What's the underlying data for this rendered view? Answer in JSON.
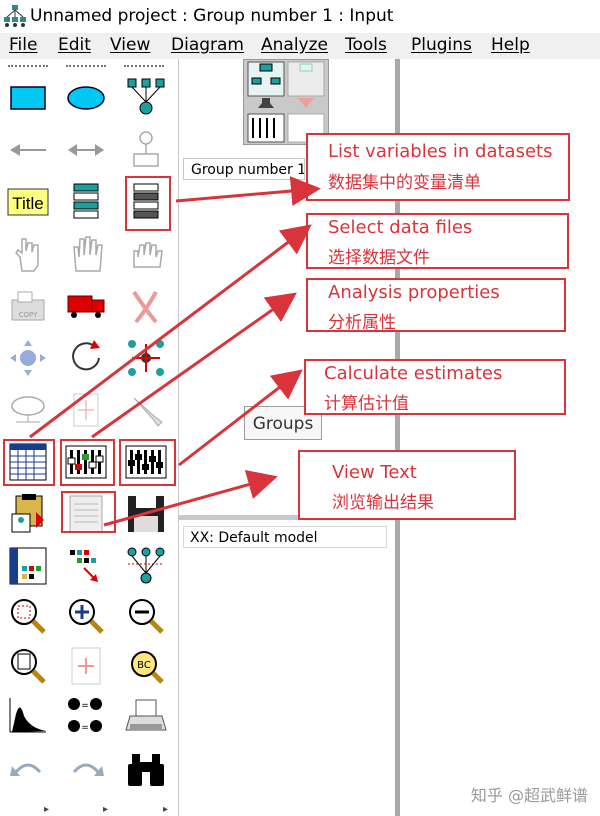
{
  "window": {
    "title": "Unnamed project : Group number 1 : Input"
  },
  "menu": [
    "File",
    "Edit",
    "View",
    "Diagram",
    "Analyze",
    "Tools",
    "Plugins",
    "Help"
  ],
  "toolbox": {
    "tools": [
      {
        "icon": "rectangle-icon"
      },
      {
        "icon": "ellipse-icon"
      },
      {
        "icon": "indicator-icon"
      },
      {
        "icon": "single-arrow-icon"
      },
      {
        "icon": "double-arrow-icon"
      },
      {
        "icon": "unique-variable-icon"
      },
      {
        "icon": "title-icon",
        "label": "Title"
      },
      {
        "icon": "list-variables-model-icon"
      },
      {
        "icon": "list-variables-dataset-icon"
      },
      {
        "icon": "select-object-icon"
      },
      {
        "icon": "select-all-icon"
      },
      {
        "icon": "deselect-icon"
      },
      {
        "icon": "copy-icon"
      },
      {
        "icon": "move-icon"
      },
      {
        "icon": "erase-icon"
      },
      {
        "icon": "resize-icon"
      },
      {
        "icon": "rotate-icon"
      },
      {
        "icon": "reflect-icon"
      },
      {
        "icon": "shape-icon"
      },
      {
        "icon": "scroll-icon"
      },
      {
        "icon": "touch-up-icon"
      },
      {
        "icon": "select-data-files-icon"
      },
      {
        "icon": "analysis-properties-icon"
      },
      {
        "icon": "calculate-estimates-icon"
      },
      {
        "icon": "copy-clipboard-icon"
      },
      {
        "icon": "view-text-icon"
      },
      {
        "icon": "save-icon"
      },
      {
        "icon": "object-properties-icon"
      },
      {
        "icon": "drag-properties-icon"
      },
      {
        "icon": "preserve-symmetries-icon"
      },
      {
        "icon": "zoom-area-icon"
      },
      {
        "icon": "zoom-in-icon"
      },
      {
        "icon": "zoom-out-icon"
      },
      {
        "icon": "show-page-icon"
      },
      {
        "icon": "fit-page-icon"
      },
      {
        "icon": "magnify-icon"
      },
      {
        "icon": "degrees-of-freedom-icon"
      },
      {
        "icon": "specification-search-icon"
      },
      {
        "icon": "print-icon"
      },
      {
        "icon": "undo-icon"
      },
      {
        "icon": "redo-icon"
      },
      {
        "icon": "binoculars-icon"
      }
    ]
  },
  "pane": {
    "group": "Group number 1",
    "groups_button": "Groups",
    "model": "XX: Default model"
  },
  "callouts": [
    {
      "en": "List variables in datasets",
      "zh": "数据集中的变量清单"
    },
    {
      "en": "Select data files",
      "zh": "选择数据文件"
    },
    {
      "en": "Analysis  properties",
      "zh": "分析属性"
    },
    {
      "en": "Calculate estimates",
      "zh": "计算估计值"
    },
    {
      "en": "View Text",
      "zh": "浏览输出结果"
    }
  ],
  "watermark": "知乎 @超武鲜谱",
  "colors": {
    "highlight": "#d9343b",
    "toolbox_bg": "#ffffff",
    "divider": "#a9a9a9"
  }
}
